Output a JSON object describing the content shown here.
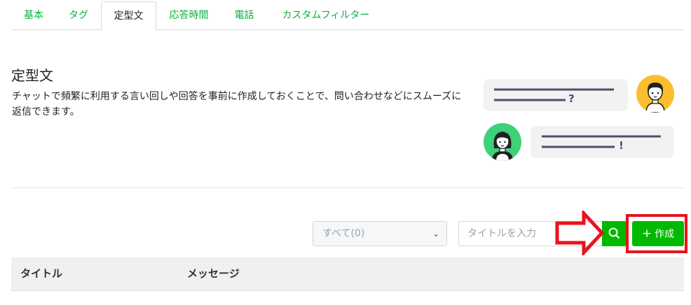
{
  "tabs": [
    {
      "label": "基本",
      "active": false
    },
    {
      "label": "タグ",
      "active": false
    },
    {
      "label": "定型文",
      "active": true
    },
    {
      "label": "応答時間",
      "active": false
    },
    {
      "label": "電話",
      "active": false
    },
    {
      "label": "カスタムフィルター",
      "active": false
    }
  ],
  "intro": {
    "title": "定型文",
    "description": "チャットで頻繁に利用する言い回しや回答を事前に作成しておくことで、問い合わせなどにスムーズに返信できます。"
  },
  "illustration": {
    "bubble_top_mark": "?",
    "bubble_bottom_mark": "!",
    "icons": [
      "male-avatar",
      "female-avatar"
    ]
  },
  "toolbar": {
    "filter_value": "すべて(0)",
    "search_placeholder": "タイトルを入力",
    "create_label": "作成",
    "search_icon": "search-icon",
    "create_icon": "plus-icon"
  },
  "table": {
    "columns": [
      "タイトル",
      "メッセージ"
    ]
  },
  "colors": {
    "brand_green": "#00b900",
    "tab_green": "#06b33b",
    "highlight_red": "#e8141c"
  }
}
